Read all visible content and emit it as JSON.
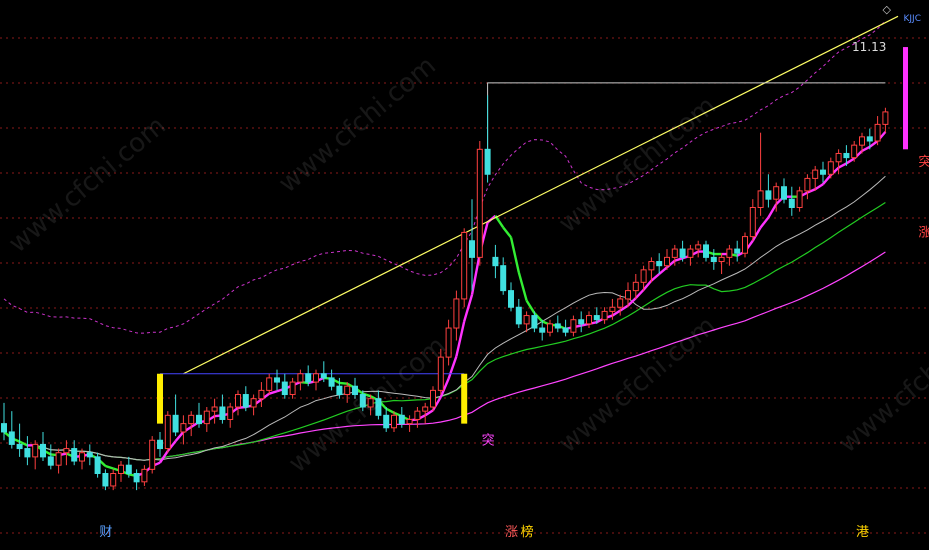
{
  "corner": {
    "diamond": "◇",
    "label": "KJJC"
  },
  "watermark": "www.cfchi.com",
  "chart_data": {
    "type": "candlestick",
    "price_label": "11.13",
    "ylim": [
      5.2,
      11.6
    ],
    "grid": "dotted horizontal",
    "candles": [
      [
        6.6,
        6.85,
        6.4,
        6.5
      ],
      [
        6.5,
        6.75,
        6.3,
        6.35
      ],
      [
        6.35,
        6.6,
        6.2,
        6.3
      ],
      [
        6.3,
        6.45,
        6.1,
        6.2
      ],
      [
        6.2,
        6.4,
        6.05,
        6.35
      ],
      [
        6.35,
        6.5,
        6.15,
        6.2
      ],
      [
        6.2,
        6.35,
        6.05,
        6.1
      ],
      [
        6.1,
        6.3,
        6.0,
        6.25
      ],
      [
        6.25,
        6.4,
        6.1,
        6.3
      ],
      [
        6.3,
        6.4,
        6.1,
        6.15
      ],
      [
        6.15,
        6.3,
        6.05,
        6.25
      ],
      [
        6.25,
        6.35,
        6.1,
        6.2
      ],
      [
        6.2,
        6.25,
        5.95,
        6.0
      ],
      [
        6.0,
        6.05,
        5.8,
        5.85
      ],
      [
        5.85,
        6.05,
        5.8,
        6.0
      ],
      [
        6.0,
        6.15,
        5.9,
        6.1
      ],
      [
        6.1,
        6.2,
        5.95,
        6.0
      ],
      [
        6.0,
        6.05,
        5.8,
        5.9
      ],
      [
        5.9,
        6.1,
        5.85,
        6.05
      ],
      [
        6.05,
        6.45,
        6.0,
        6.4
      ],
      [
        6.4,
        6.5,
        6.2,
        6.3
      ],
      [
        6.3,
        6.75,
        6.25,
        6.7
      ],
      [
        6.7,
        6.95,
        6.45,
        6.5
      ],
      [
        6.5,
        6.7,
        6.35,
        6.6
      ],
      [
        6.6,
        6.75,
        6.45,
        6.7
      ],
      [
        6.7,
        6.85,
        6.55,
        6.6
      ],
      [
        6.6,
        6.8,
        6.5,
        6.75
      ],
      [
        6.75,
        6.9,
        6.6,
        6.8
      ],
      [
        6.8,
        6.95,
        6.6,
        6.65
      ],
      [
        6.65,
        6.85,
        6.55,
        6.8
      ],
      [
        6.8,
        7.0,
        6.7,
        6.95
      ],
      [
        6.95,
        7.05,
        6.75,
        6.8
      ],
      [
        6.8,
        6.95,
        6.7,
        6.9
      ],
      [
        6.9,
        7.1,
        6.8,
        7.0
      ],
      [
        7.0,
        7.2,
        6.95,
        7.15
      ],
      [
        7.15,
        7.25,
        7.0,
        7.1
      ],
      [
        7.1,
        7.2,
        6.9,
        6.95
      ],
      [
        6.95,
        7.15,
        6.9,
        7.1
      ],
      [
        7.1,
        7.25,
        7.0,
        7.2
      ],
      [
        7.2,
        7.3,
        7.05,
        7.1
      ],
      [
        7.1,
        7.25,
        7.0,
        7.2
      ],
      [
        7.2,
        7.35,
        7.1,
        7.15
      ],
      [
        7.15,
        7.25,
        7.0,
        7.05
      ],
      [
        7.05,
        7.15,
        6.9,
        6.95
      ],
      [
        6.95,
        7.1,
        6.85,
        7.05
      ],
      [
        7.05,
        7.15,
        6.9,
        6.95
      ],
      [
        6.95,
        7.0,
        6.75,
        6.8
      ],
      [
        6.8,
        6.95,
        6.7,
        6.9
      ],
      [
        6.9,
        7.0,
        6.65,
        6.7
      ],
      [
        6.7,
        6.8,
        6.5,
        6.55
      ],
      [
        6.55,
        6.75,
        6.5,
        6.7
      ],
      [
        6.7,
        6.8,
        6.55,
        6.6
      ],
      [
        6.6,
        6.7,
        6.5,
        6.65
      ],
      [
        6.65,
        6.8,
        6.55,
        6.75
      ],
      [
        6.75,
        6.85,
        6.6,
        6.8
      ],
      [
        6.8,
        7.05,
        6.75,
        7.0
      ],
      [
        7.0,
        7.5,
        6.95,
        7.4
      ],
      [
        7.4,
        7.85,
        7.3,
        7.75
      ],
      [
        7.75,
        8.2,
        7.6,
        8.1
      ],
      [
        8.1,
        8.95,
        8.0,
        8.9
      ],
      [
        8.8,
        9.3,
        8.2,
        8.6
      ],
      [
        8.6,
        10.0,
        8.5,
        9.9
      ],
      [
        9.9,
        10.55,
        9.5,
        9.6
      ],
      [
        8.6,
        8.75,
        8.35,
        8.5
      ],
      [
        8.5,
        8.6,
        8.15,
        8.2
      ],
      [
        8.2,
        8.3,
        7.95,
        8.0
      ],
      [
        8.0,
        8.1,
        7.75,
        7.8
      ],
      [
        7.8,
        7.95,
        7.7,
        7.9
      ],
      [
        7.9,
        7.95,
        7.7,
        7.75
      ],
      [
        7.75,
        7.85,
        7.6,
        7.7
      ],
      [
        7.7,
        7.85,
        7.65,
        7.8
      ],
      [
        7.8,
        7.9,
        7.7,
        7.75
      ],
      [
        7.75,
        7.85,
        7.65,
        7.7
      ],
      [
        7.7,
        7.9,
        7.65,
        7.85
      ],
      [
        7.85,
        7.95,
        7.7,
        7.8
      ],
      [
        7.8,
        7.95,
        7.75,
        7.9
      ],
      [
        7.9,
        8.0,
        7.8,
        7.85
      ],
      [
        7.85,
        8.0,
        7.8,
        7.95
      ],
      [
        7.95,
        8.1,
        7.85,
        8.0
      ],
      [
        8.0,
        8.15,
        7.9,
        8.1
      ],
      [
        8.1,
        8.3,
        8.0,
        8.2
      ],
      [
        8.2,
        8.4,
        8.1,
        8.3
      ],
      [
        8.3,
        8.5,
        8.2,
        8.45
      ],
      [
        8.45,
        8.6,
        8.3,
        8.55
      ],
      [
        8.55,
        8.65,
        8.4,
        8.5
      ],
      [
        8.5,
        8.7,
        8.45,
        8.6
      ],
      [
        8.6,
        8.75,
        8.5,
        8.7
      ],
      [
        8.7,
        8.8,
        8.55,
        8.6
      ],
      [
        8.6,
        8.75,
        8.5,
        8.7
      ],
      [
        8.7,
        8.8,
        8.6,
        8.75
      ],
      [
        8.75,
        8.8,
        8.55,
        8.6
      ],
      [
        8.6,
        8.7,
        8.45,
        8.55
      ],
      [
        8.55,
        8.65,
        8.4,
        8.6
      ],
      [
        8.6,
        8.75,
        8.5,
        8.7
      ],
      [
        8.7,
        8.8,
        8.55,
        8.65
      ],
      [
        8.65,
        8.9,
        8.6,
        8.85
      ],
      [
        8.85,
        9.3,
        8.8,
        9.2
      ],
      [
        9.2,
        10.1,
        9.1,
        9.4
      ],
      [
        9.4,
        9.6,
        9.2,
        9.3
      ],
      [
        9.3,
        9.5,
        9.15,
        9.45
      ],
      [
        9.45,
        9.55,
        9.25,
        9.3
      ],
      [
        9.3,
        9.45,
        9.1,
        9.2
      ],
      [
        9.2,
        9.45,
        9.15,
        9.4
      ],
      [
        9.4,
        9.6,
        9.3,
        9.55
      ],
      [
        9.55,
        9.7,
        9.4,
        9.65
      ],
      [
        9.65,
        9.75,
        9.5,
        9.6
      ],
      [
        9.6,
        9.8,
        9.55,
        9.75
      ],
      [
        9.75,
        9.9,
        9.6,
        9.85
      ],
      [
        9.85,
        9.95,
        9.7,
        9.8
      ],
      [
        9.8,
        10.0,
        9.75,
        9.95
      ],
      [
        9.95,
        10.1,
        9.85,
        10.05
      ],
      [
        10.05,
        10.15,
        9.9,
        10.0
      ],
      [
        10.0,
        10.3,
        9.95,
        10.2
      ],
      [
        10.2,
        10.4,
        10.1,
        10.35
      ]
    ],
    "first_x": 4,
    "step": 7.8,
    "highlight": {
      "yellow": [
        20,
        59
      ],
      "magenta_bar": {
        "from": 9.9,
        "to": 11.13
      }
    },
    "annotations": [
      {
        "text": "突",
        "index": 62,
        "price": 6.35,
        "color": "#ff44ff"
      },
      {
        "text": "突",
        "index": 118,
        "price": 9.7,
        "color": "#ff4444"
      },
      {
        "text": "涨",
        "index": 118,
        "price": 8.85,
        "color": "#ff4444"
      },
      {
        "text": "财",
        "index": 13,
        "price": 5.25,
        "color": "#5aa0ff"
      },
      {
        "text": "涨",
        "index": 65,
        "price": 5.25,
        "color": "#ff5a5a"
      },
      {
        "text": "榜",
        "index": 67,
        "price": 5.25,
        "color": "#ffd400"
      },
      {
        "text": "港",
        "index": 110,
        "price": 5.25,
        "color": "#ffd400"
      }
    ]
  }
}
